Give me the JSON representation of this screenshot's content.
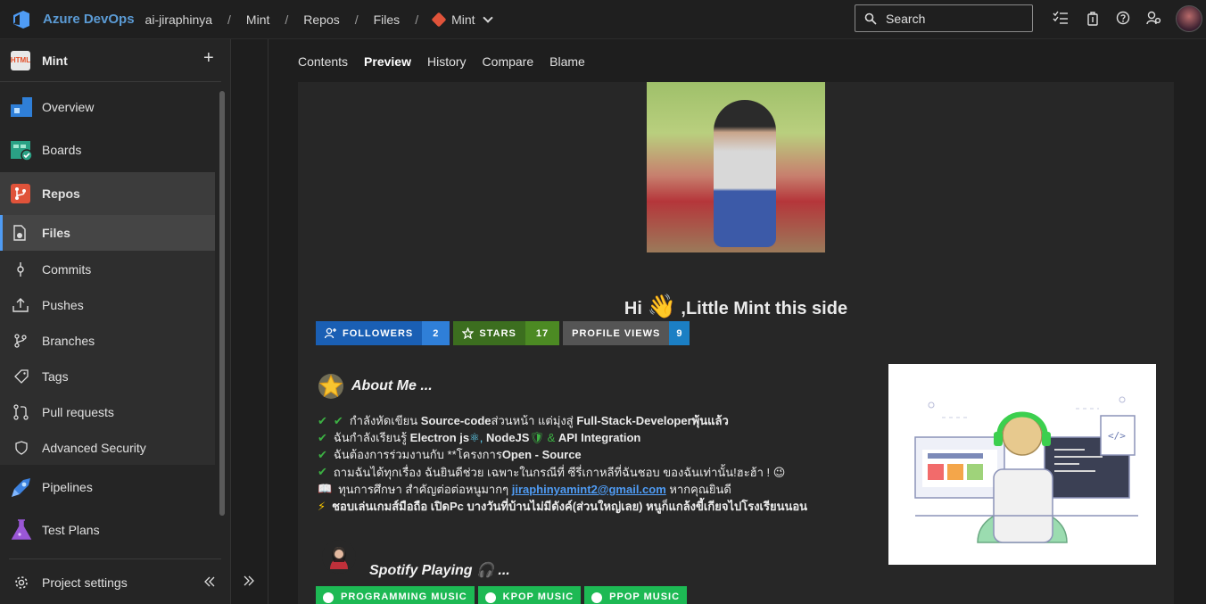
{
  "topbar": {
    "brand": "Azure DevOps",
    "org": "ai-jiraphinya",
    "crumbs": [
      "Mint",
      "Repos",
      "Files"
    ],
    "sep": "/",
    "repo": "Mint",
    "search_label": "Search"
  },
  "sidebar": {
    "project": "Mint",
    "project_icon_text": "HTML",
    "items": [
      {
        "label": "Overview"
      },
      {
        "label": "Boards"
      },
      {
        "label": "Repos"
      },
      {
        "label": "Files"
      },
      {
        "label": "Commits"
      },
      {
        "label": "Pushes"
      },
      {
        "label": "Branches"
      },
      {
        "label": "Tags"
      },
      {
        "label": "Pull requests"
      },
      {
        "label": "Advanced Security"
      },
      {
        "label": "Pipelines"
      },
      {
        "label": "Test Plans"
      }
    ],
    "settings": "Project settings"
  },
  "tabs": [
    "Contents",
    "Preview",
    "History",
    "Compare",
    "Blame"
  ],
  "readme": {
    "hi_prefix": "Hi",
    "hi_emoji": "👋",
    "hi_suffix": ",Little Mint this side",
    "badges": [
      {
        "label": "FOLLOWERS",
        "value": "2",
        "lcolor": "#1a5fb4",
        "rcolor": "#2f7fd8"
      },
      {
        "label": "STARS",
        "value": "17",
        "lcolor": "#3c6e1f",
        "rcolor": "#4c8a23"
      },
      {
        "label": "PROFILE VIEWS",
        "value": "9",
        "lcolor": "#555555",
        "rcolor": "#1b7fc4"
      }
    ],
    "about_title": "About Me ...",
    "lines": [
      {
        "a": "✔",
        "b": "✔",
        "pre": "กำลังหัดเขียน ",
        "bold1": "Source-code",
        "mid": " ส่วนหน้า แต่มุ่งสู่ ",
        "bold2": "Full-Stack-Developer",
        "post": " พุ้นแล้ว"
      },
      {
        "a": "✔",
        "pre": "ฉันกำลังเรียนรู้ ",
        "bold1": "Electron js",
        "mid": " ⚛, ",
        "bold2": "NodeJS",
        "mid2": "🛡 & ",
        "bold3": "API Integration"
      },
      {
        "a": "✔",
        "pre": "ฉันต้องการร่วมงานกับ **โครงการ ",
        "bold1": "Open - Source"
      },
      {
        "a": "✔",
        "pre": "ถามฉันได้ทุกเรื่อง ฉันยินดีช่วย เฉพาะในกรณีที่ ซีรี่เกาหลีที่ฉันชอบ ของฉันเท่านั้น!ฮะฮ้า ! 😉"
      },
      {
        "a": "📖",
        "pre": "ทุนการศึกษา สำคัญต่อต่อหนูมากๆ ",
        "link": "jiraphinyamint2@gmail.com",
        "post": " หากคุณยินดี"
      },
      {
        "a": "⚡",
        "bold1": "ชอบเล่นเกมส์มือถือ เปิดPc บางวันที่บ้านไม่มีดังค์(ส่วนใหญ่เลย) หนูก็แกล้งขี้เกียจไปโรงเรียนนอน"
      }
    ],
    "spotify_title": "Spotify Playing 🎧 ...",
    "spotify_buttons": [
      "PROGRAMMING MUSIC",
      "KPOP MUSIC",
      "PPOP MUSIC"
    ]
  }
}
